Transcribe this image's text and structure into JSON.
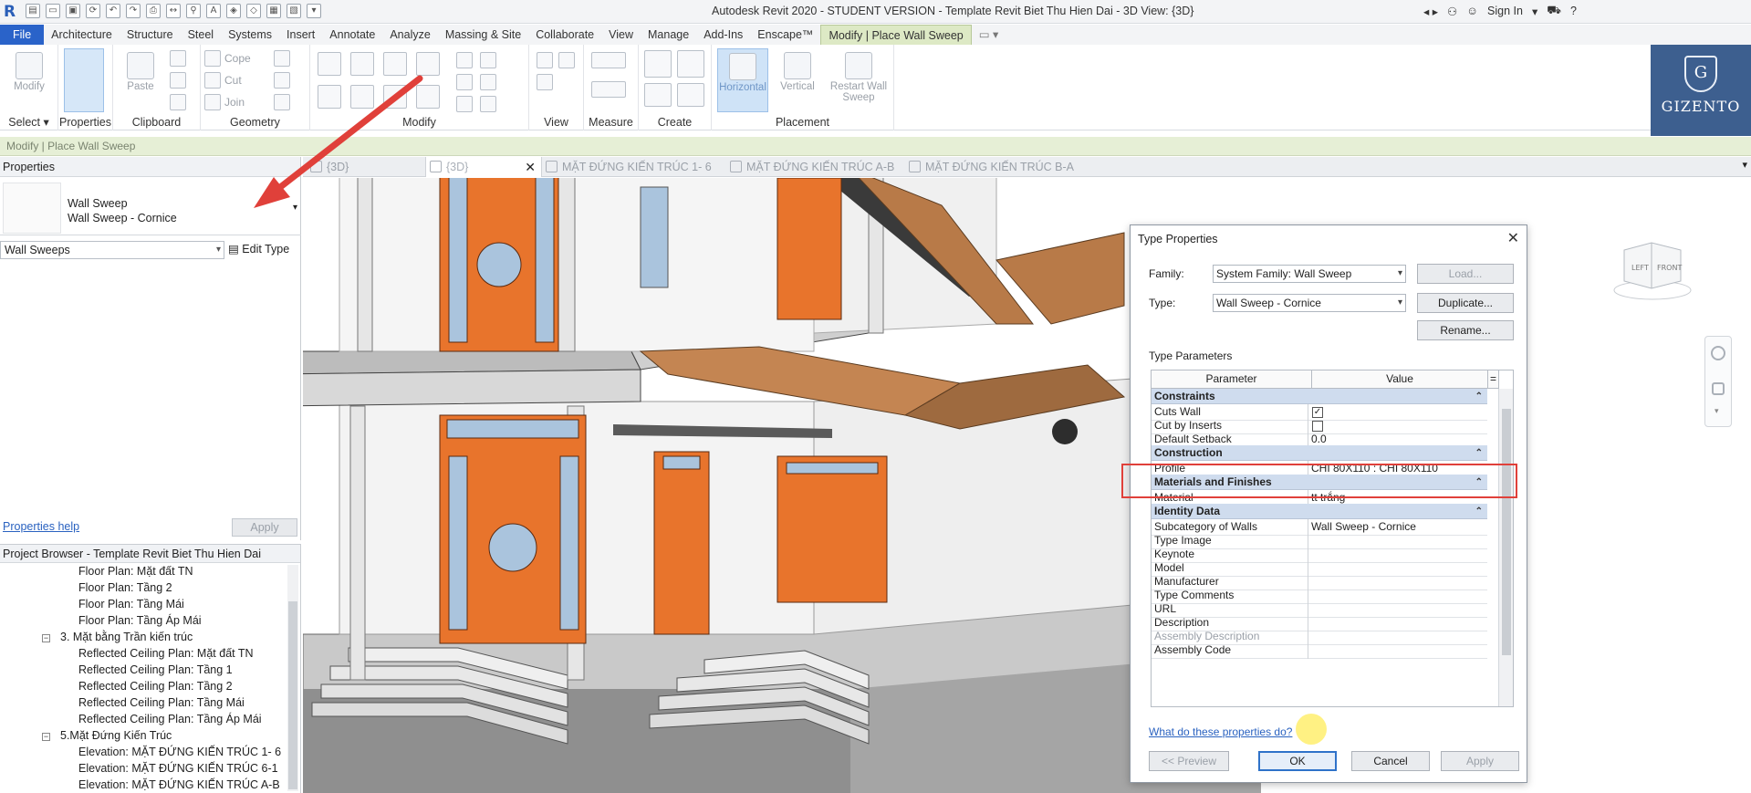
{
  "app": {
    "logo": "R",
    "title": "Autodesk Revit 2020 - STUDENT VERSION - Template Revit Biet Thu Hien Dai - 3D View: {3D}",
    "sign_in": "Sign In"
  },
  "brand": {
    "name": "GIZENTO",
    "letter": "G"
  },
  "tabs": [
    "File",
    "Architecture",
    "Structure",
    "Steel",
    "Systems",
    "Insert",
    "Annotate",
    "Analyze",
    "Massing & Site",
    "Collaborate",
    "View",
    "Manage",
    "Add-Ins",
    "Enscape™",
    "Modify | Place Wall Sweep"
  ],
  "ribbon": {
    "modify": "Modify",
    "select": "Select",
    "properties": "Properties",
    "paste": "Paste",
    "clipboard": "Clipboard",
    "cope": "Cope",
    "cut": "Cut",
    "join": "Join",
    "geometry": "Geometry",
    "modify_panel": "Modify",
    "view": "View",
    "measure": "Measure",
    "create": "Create",
    "horizontal": "Horizontal",
    "vertical": "Vertical",
    "restart": "Restart Wall Sweep",
    "placement": "Placement"
  },
  "context_bar": "Modify | Place Wall Sweep",
  "properties": {
    "header": "Properties",
    "type_family": "Wall Sweep",
    "type_name": "Wall Sweep - Cornice",
    "filter": "Wall Sweeps",
    "edit_type": "Edit Type",
    "help": "Properties help",
    "apply": "Apply"
  },
  "browser": {
    "header": "Project Browser - Template Revit Biet Thu Hien Dai",
    "items": [
      {
        "label": "Floor Plan: Mặt đất TN",
        "level": 2
      },
      {
        "label": "Floor Plan: Tầng 2",
        "level": 2
      },
      {
        "label": "Floor Plan: Tầng Mái",
        "level": 2
      },
      {
        "label": "Floor Plan: Tầng Áp Mái",
        "level": 2
      },
      {
        "label": "3. Mặt bằng Trần kiến trúc",
        "level": 1
      },
      {
        "label": "Reflected Ceiling Plan: Mặt đất TN",
        "level": 2
      },
      {
        "label": "Reflected Ceiling Plan: Tầng 1",
        "level": 2
      },
      {
        "label": "Reflected Ceiling Plan: Tầng 2",
        "level": 2
      },
      {
        "label": "Reflected Ceiling Plan: Tầng Mái",
        "level": 2
      },
      {
        "label": "Reflected Ceiling Plan: Tầng Áp Mái",
        "level": 2
      },
      {
        "label": "5.Mặt Đứng Kiến Trúc",
        "level": 1
      },
      {
        "label": "Elevation: MẶT ĐỨNG KIẾN TRÚC 1- 6",
        "level": 2
      },
      {
        "label": "Elevation: MẶT ĐỨNG KIẾN TRÚC 6-1",
        "level": 2
      },
      {
        "label": "Elevation: MẶT ĐỨNG KIẾN TRÚC A-B",
        "level": 2
      }
    ]
  },
  "view_tabs": [
    {
      "label": "{3D}",
      "current": false
    },
    {
      "label": "{3D}",
      "current": true
    },
    {
      "label": "MẶT ĐỨNG KIẾN TRÚC 1- 6",
      "current": false
    },
    {
      "label": "MẶT ĐỨNG KIẾN TRÚC A-B",
      "current": false
    },
    {
      "label": "MẶT ĐỨNG KIẾN TRÚC B-A",
      "current": false
    }
  ],
  "viewcube": {
    "left": "LEFT",
    "front": "FRONT"
  },
  "dialog": {
    "title": "Type Properties",
    "family_label": "Family:",
    "family_value": "System Family: Wall Sweep",
    "type_label": "Type:",
    "type_value": "Wall Sweep - Cornice",
    "load": "Load...",
    "duplicate": "Duplicate...",
    "rename": "Rename...",
    "type_parameters": "Type Parameters",
    "col_parameter": "Parameter",
    "col_value": "Value",
    "col_extra": "=",
    "sections": [
      {
        "name": "Constraints",
        "rows": [
          {
            "param": "Cuts Wall",
            "value": "",
            "check": true
          },
          {
            "param": "Cut by Inserts",
            "value": "",
            "check": false
          },
          {
            "param": "Default Setback",
            "value": "0.0"
          }
        ]
      },
      {
        "name": "Construction",
        "rows": [
          {
            "param": "Profile",
            "value": "CHI 80X110 : CHI 80X110"
          }
        ]
      },
      {
        "name": "Materials and Finishes",
        "rows": [
          {
            "param": "Material",
            "value": "tt trắng"
          }
        ]
      },
      {
        "name": "Identity Data",
        "rows": [
          {
            "param": "Subcategory of Walls",
            "value": "Wall Sweep - Cornice"
          },
          {
            "param": "Type Image",
            "value": ""
          },
          {
            "param": "Keynote",
            "value": ""
          },
          {
            "param": "Model",
            "value": ""
          },
          {
            "param": "Manufacturer",
            "value": ""
          },
          {
            "param": "Type Comments",
            "value": ""
          },
          {
            "param": "URL",
            "value": ""
          },
          {
            "param": "Description",
            "value": ""
          },
          {
            "param": "Assembly Description",
            "value": "",
            "muted": true
          },
          {
            "param": "Assembly Code",
            "value": ""
          }
        ]
      }
    ],
    "help_link": "What do these properties do?",
    "preview": "<< Preview",
    "ok": "OK",
    "cancel": "Cancel",
    "apply": "Apply"
  },
  "colors": {
    "accent": "#2a63c9",
    "highlight": "#e0403a",
    "door": "#e8742c",
    "section_header": "#cfdcee"
  }
}
